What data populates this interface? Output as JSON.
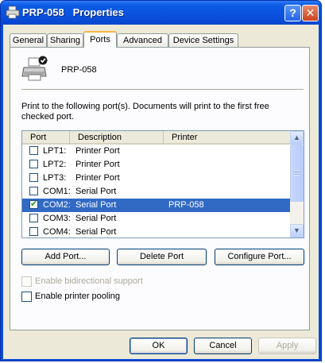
{
  "window": {
    "title": "PRP-058   Properties",
    "help_glyph": "?",
    "close_glyph": "✕"
  },
  "tabs": [
    {
      "label": "General",
      "active": false
    },
    {
      "label": "Sharing",
      "active": false
    },
    {
      "label": "Ports",
      "active": true
    },
    {
      "label": "Advanced",
      "active": false
    },
    {
      "label": "Device Settings",
      "active": false
    }
  ],
  "printer": {
    "name": "PRP-058",
    "icon": "printer-icon"
  },
  "instructions": "Print to the following port(s). Documents will print to the first free checked port.",
  "port_list": {
    "columns": [
      "Port",
      "Description",
      "Printer"
    ],
    "rows": [
      {
        "port": "LPT1:",
        "description": "Printer Port",
        "printer": "",
        "checked": false,
        "selected": false
      },
      {
        "port": "LPT2:",
        "description": "Printer Port",
        "printer": "",
        "checked": false,
        "selected": false
      },
      {
        "port": "LPT3:",
        "description": "Printer Port",
        "printer": "",
        "checked": false,
        "selected": false
      },
      {
        "port": "COM1:",
        "description": "Serial Port",
        "printer": "",
        "checked": false,
        "selected": false
      },
      {
        "port": "COM2:",
        "description": "Serial Port",
        "printer": "PRP-058",
        "checked": true,
        "selected": true
      },
      {
        "port": "COM3:",
        "description": "Serial Port",
        "printer": "",
        "checked": false,
        "selected": false
      },
      {
        "port": "COM4:",
        "description": "Serial Port",
        "printer": "",
        "checked": false,
        "selected": false
      }
    ]
  },
  "port_buttons": {
    "add": "Add Port...",
    "delete": "Delete Port",
    "configure": "Configure Port..."
  },
  "options": {
    "bidirectional": {
      "label": "Enable bidirectional support",
      "checked": false,
      "enabled": false
    },
    "pooling": {
      "label": "Enable printer pooling",
      "checked": false,
      "enabled": true
    }
  },
  "dialog_buttons": {
    "ok": "OK",
    "cancel": "Cancel",
    "apply": "Apply"
  },
  "colors": {
    "titlebar": "#0a52de",
    "selection": "#316ac5",
    "active_tab_accent": "#f9b447"
  }
}
